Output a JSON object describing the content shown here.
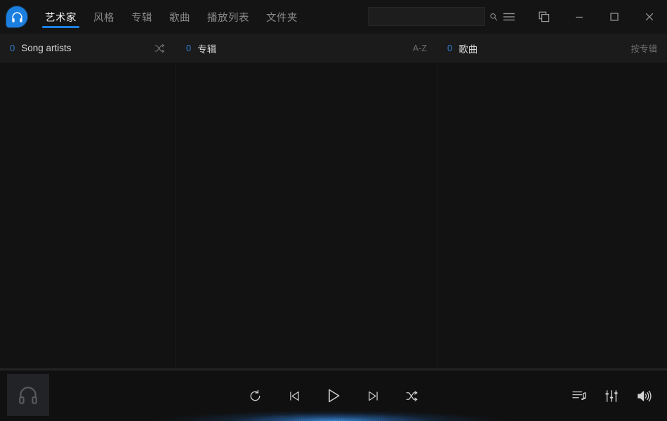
{
  "app": {
    "logo_icon": "headphones-logo-icon",
    "accent_color": "#1b7fe0"
  },
  "titlebar": {
    "tabs": [
      {
        "label": "艺术家",
        "active": true
      },
      {
        "label": "风格",
        "active": false
      },
      {
        "label": "专辑",
        "active": false
      },
      {
        "label": "歌曲",
        "active": false
      },
      {
        "label": "播放列表",
        "active": false
      },
      {
        "label": "文件夹",
        "active": false
      }
    ],
    "search": {
      "value": "",
      "placeholder": "",
      "icon": "search-icon"
    },
    "window_buttons": [
      {
        "name": "menu-button",
        "icon": "hamburger-menu-icon"
      },
      {
        "name": "mini-mode-button",
        "icon": "restore-windows-icon"
      },
      {
        "name": "minimize-button",
        "icon": "minimize-icon"
      },
      {
        "name": "maximize-button",
        "icon": "maximize-icon"
      },
      {
        "name": "close-button",
        "icon": "close-icon"
      }
    ]
  },
  "columns": [
    {
      "count": "0",
      "title": "Song artists",
      "action_label": "",
      "action_icon": "shuffle-icon",
      "items": []
    },
    {
      "count": "0",
      "title": "专辑",
      "action_label": "A-Z",
      "action_icon": "",
      "items": []
    },
    {
      "count": "0",
      "title": "歌曲",
      "action_label": "按专辑",
      "action_icon": "",
      "items": []
    }
  ],
  "player": {
    "album_art_icon": "headphones-placeholder-icon",
    "progress_percent": "0",
    "transport": [
      {
        "name": "repeat-button",
        "icon": "repeat-icon"
      },
      {
        "name": "previous-button",
        "icon": "previous-track-icon"
      },
      {
        "name": "play-button",
        "icon": "play-icon"
      },
      {
        "name": "next-button",
        "icon": "next-track-icon"
      },
      {
        "name": "shuffle-button",
        "icon": "shuffle-icon"
      }
    ],
    "right_controls": [
      {
        "name": "playlist-queue-button",
        "icon": "playlist-queue-icon"
      },
      {
        "name": "equalizer-button",
        "icon": "equalizer-icon"
      },
      {
        "name": "volume-button",
        "icon": "volume-icon"
      }
    ]
  }
}
